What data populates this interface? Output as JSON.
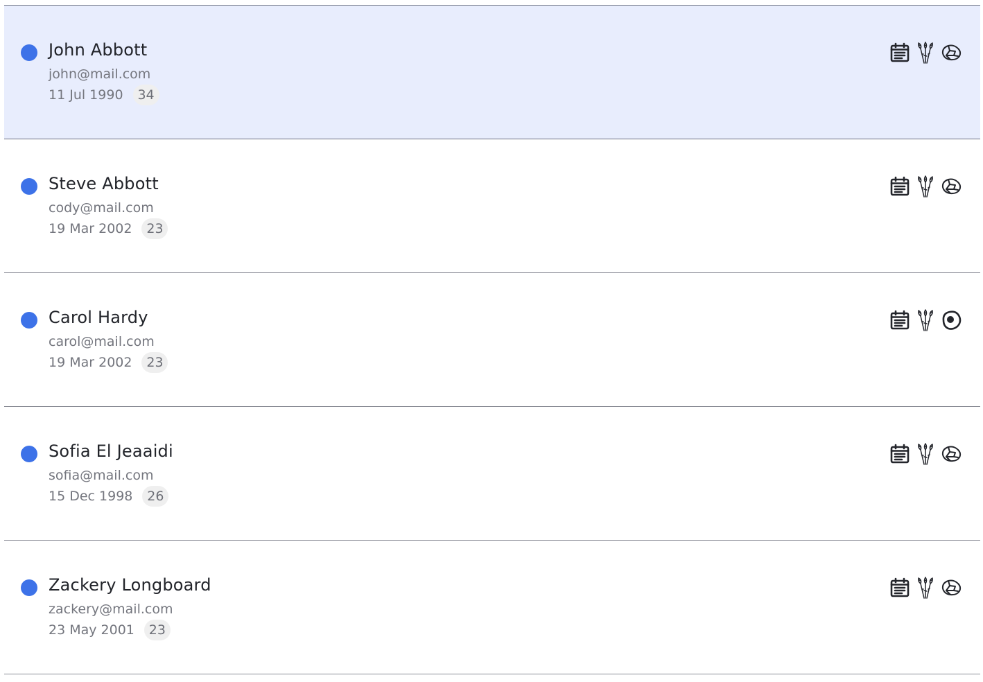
{
  "people": [
    {
      "name": "John Abbott",
      "email": "john@mail.com",
      "dob": "11 Jul 1990",
      "age": "34",
      "selected": true,
      "third_icon": "egg-cracked-icon"
    },
    {
      "name": "Steve Abbott",
      "email": "cody@mail.com",
      "dob": "19 Mar 2002",
      "age": "23",
      "selected": false,
      "third_icon": "egg-cracked-icon"
    },
    {
      "name": "Carol Hardy",
      "email": "carol@mail.com",
      "dob": "19 Mar 2002",
      "age": "23",
      "selected": false,
      "third_icon": "egg-fried-icon"
    },
    {
      "name": "Sofia El Jeaaidi",
      "email": "sofia@mail.com",
      "dob": "15 Dec 1998",
      "age": "26",
      "selected": false,
      "third_icon": "egg-cracked-icon"
    },
    {
      "name": "Zackery Longboard",
      "email": "zackery@mail.com",
      "dob": "23 May 2001",
      "age": "23",
      "selected": false,
      "third_icon": "egg-cracked-icon"
    }
  ],
  "icons": {
    "first": "calendar-notes-icon",
    "second": "asparagus-icon"
  },
  "colors": {
    "status_dot": "#3d72e8",
    "selected_row": "#e8edfd",
    "name_text": "#22242a",
    "secondary_text": "#74767e"
  }
}
